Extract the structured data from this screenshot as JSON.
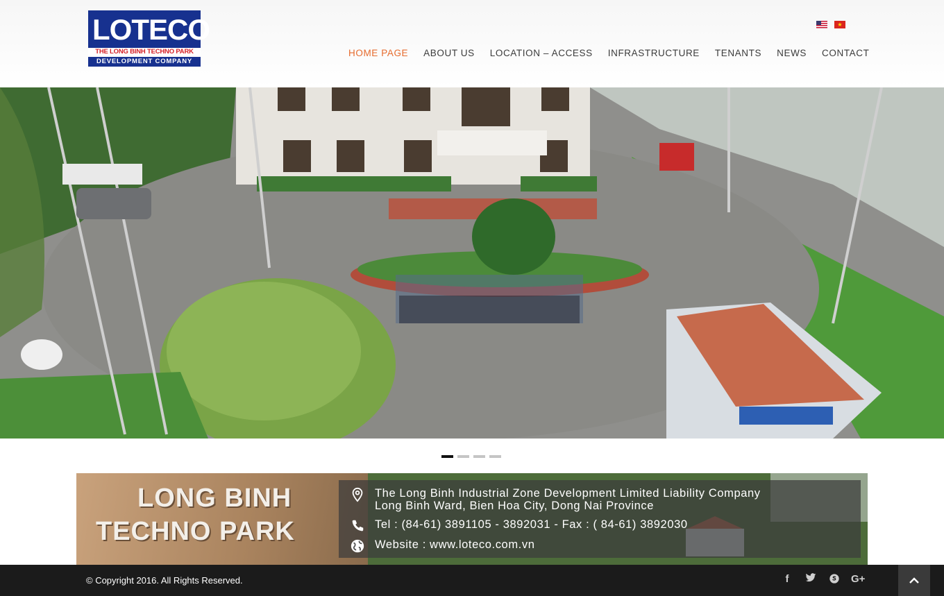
{
  "brand": {
    "logo_word_main": "L",
    "logo_word_rest": "OTECO",
    "logo_line1": "THE LONG BINH TECHNO PARK",
    "logo_line2": "DEVELOPMENT COMPANY"
  },
  "languages": [
    "English",
    "Vietnamese"
  ],
  "nav": {
    "items": [
      {
        "label": "HOME PAGE",
        "active": true
      },
      {
        "label": "ABOUT US"
      },
      {
        "label": "LOCATION – ACCESS"
      },
      {
        "label": "INFRASTRUCTURE"
      },
      {
        "label": "TENANTS"
      },
      {
        "label": "NEWS"
      },
      {
        "label": "CONTACT"
      }
    ]
  },
  "slider": {
    "count": 4,
    "active": 0
  },
  "banner": {
    "sign_line1": "LONG BINH",
    "sign_line2": "TECHNO PARK",
    "company": "The Long Binh Industrial Zone Development Limited Liability Company",
    "address": "Long Binh Ward, Bien Hoa City, Dong Nai Province",
    "phone": "Tel : (84-61) 3891105 - 3892031 - Fax : ( 84-61) 3892030",
    "website": "Website : www.loteco.com.vn"
  },
  "footer": {
    "copyright": "© Copyright 2016. All Rights Reserved.",
    "social": [
      "facebook-icon",
      "twitter-icon",
      "skype-icon",
      "google-plus-icon"
    ]
  },
  "colors": {
    "accent": "#e66b2d",
    "brand": "#17318f",
    "footer": "#1b1b1b"
  }
}
